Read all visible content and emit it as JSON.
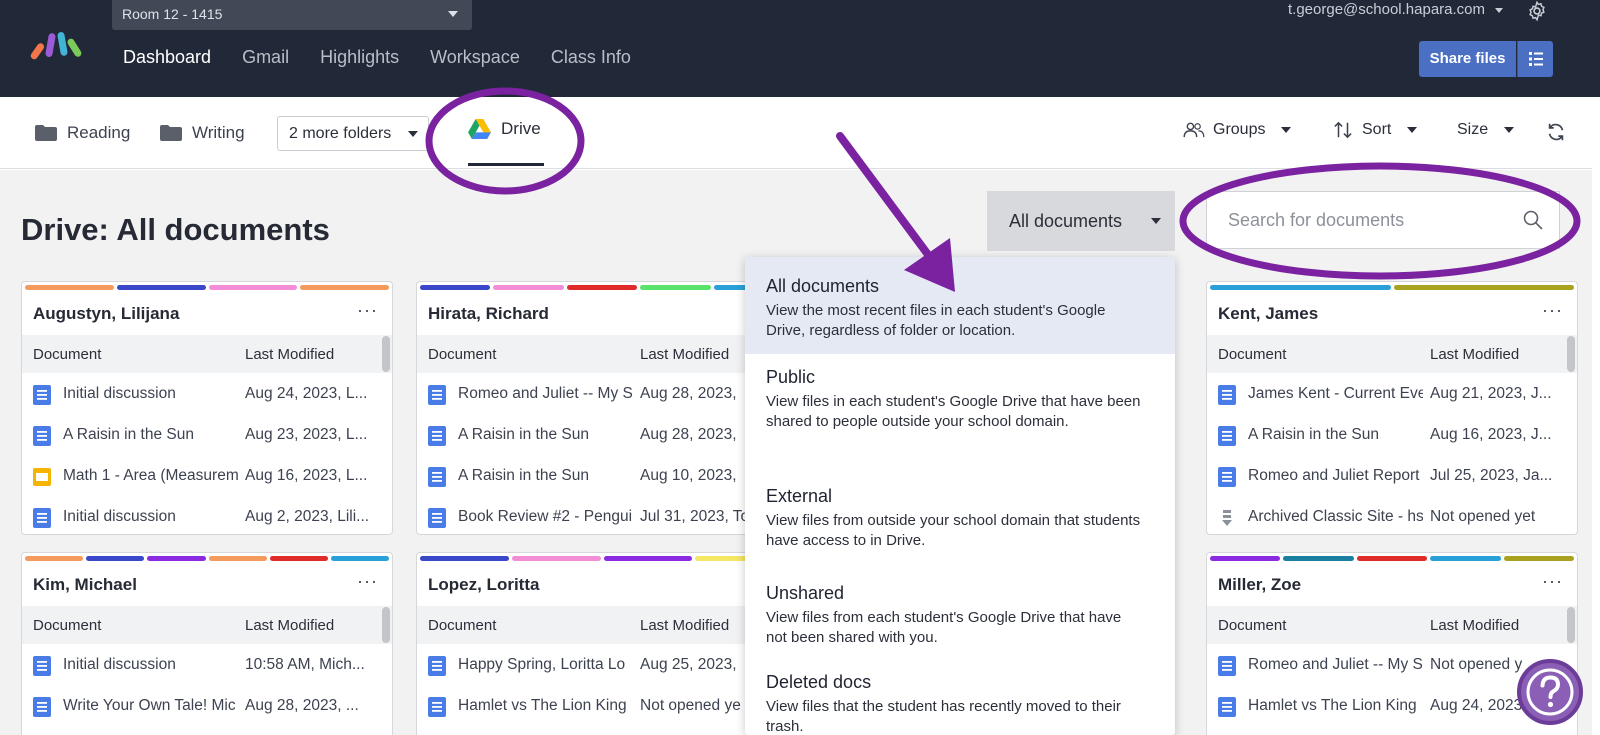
{
  "header": {
    "class_select": "Room 12 - 1415",
    "nav": [
      "Dashboard",
      "Gmail",
      "Highlights",
      "Workspace",
      "Class Info"
    ],
    "active_nav": "Dashboard",
    "account": "t.george@school.hapara.com",
    "share_button": "Share files"
  },
  "folderbar": {
    "folders": [
      "Reading",
      "Writing"
    ],
    "more_folders": "2 more folders",
    "drive_tab": "Drive",
    "groups": "Groups",
    "sort": "Sort",
    "size": "Size"
  },
  "main": {
    "title": "Drive: All documents",
    "filter": "All documents",
    "search_placeholder": "Search for documents"
  },
  "columns": {
    "document": "Document",
    "last_modified": "Last Modified"
  },
  "cards": [
    {
      "name": "Augustyn, Lilijana",
      "stripe": [
        "#f39a5c",
        "#3a47c9",
        "#f38ed6",
        "#f39a5c"
      ],
      "rows": [
        {
          "icon": "doc",
          "name": "Initial discussion",
          "date": "Aug 24, 2023, L..."
        },
        {
          "icon": "doc",
          "name": "A Raisin in the Sun",
          "date": "Aug 23, 2023, L..."
        },
        {
          "icon": "slides",
          "name": "Math 1 - Area (Measurem",
          "date": "Aug 16, 2023, L..."
        },
        {
          "icon": "doc",
          "name": "Initial discussion",
          "date": "Aug 2, 2023, Lili..."
        }
      ]
    },
    {
      "name": "Hirata, Richard",
      "stripe": [
        "#3a47c9",
        "#f38ed6",
        "#e02b2b",
        "#5ae36b",
        "#2aa0d8"
      ],
      "rows": [
        {
          "icon": "doc",
          "name": "Romeo and Juliet -- My St",
          "date": "Aug 28, 2023,"
        },
        {
          "icon": "doc",
          "name": "A Raisin in the Sun",
          "date": "Aug 28, 2023,"
        },
        {
          "icon": "doc",
          "name": "A Raisin in the Sun",
          "date": "Aug 10, 2023,"
        },
        {
          "icon": "doc",
          "name": "Book Review #2 - Pengui",
          "date": "Jul 31, 2023, To"
        }
      ]
    },
    {
      "name": "Kent, James",
      "stripe": [
        "#2aa0d8",
        "#a8a21e"
      ],
      "rows": [
        {
          "icon": "doc",
          "name": "James Kent - Current Eve",
          "date": "Aug 21, 2023, J..."
        },
        {
          "icon": "doc",
          "name": "A Raisin in the Sun",
          "date": "Aug 16, 2023, J..."
        },
        {
          "icon": "doc",
          "name": "Romeo and Juliet Report",
          "date": "Jul 25, 2023, Ja..."
        },
        {
          "icon": "site",
          "name": "Archived Classic Site - hs",
          "date": "Not opened yet"
        }
      ]
    },
    {
      "name": "Kim, Michael",
      "stripe": [
        "#f39a5c",
        "#3a47c9",
        "#8a2be2",
        "#f39a5c",
        "#e02b2b",
        "#2aa0d8"
      ],
      "rows": [
        {
          "icon": "doc",
          "name": "Initial discussion",
          "date": "10:58 AM, Mich..."
        },
        {
          "icon": "doc",
          "name": "Write Your Own Tale! Mic",
          "date": "Aug 28, 2023, ..."
        }
      ]
    },
    {
      "name": "Lopez, Loritta",
      "stripe": [
        "#3a47c9",
        "#f38ed6",
        "#8a2be2",
        "#f5e663"
      ],
      "rows": [
        {
          "icon": "doc",
          "name": "Happy Spring, Loritta Lo",
          "date": "Aug 25, 2023,"
        },
        {
          "icon": "doc",
          "name": "Hamlet vs The Lion King",
          "date": "Not opened ye"
        }
      ]
    },
    {
      "name": "Miller, Zoe",
      "stripe": [
        "#8a2be2",
        "#1a7fa0",
        "#e02b2b",
        "#2aa0d8",
        "#a8a21e"
      ],
      "rows": [
        {
          "icon": "doc",
          "name": "Romeo and Juliet -- My St",
          "date": "Not opened y"
        },
        {
          "icon": "doc",
          "name": "Hamlet vs The Lion King",
          "date": "Aug 24, 2023,"
        }
      ]
    }
  ],
  "dropdown": [
    {
      "title": "All documents",
      "desc": "View the most recent files in each student's Google Drive, regardless of folder or location.",
      "selected": true
    },
    {
      "title": "Public",
      "desc": "View files in each student's Google Drive that have been shared to people outside your school domain.",
      "selected": false
    },
    {
      "title": "External",
      "desc": "View files from outside your school domain that students have access to in Drive.",
      "selected": false
    },
    {
      "title": "Unshared",
      "desc": "View files from each student's Google Drive that have not been shared with you.",
      "selected": false
    },
    {
      "title": "Deleted docs",
      "desc": "View files that the student has recently moved to their trash.",
      "selected": false
    }
  ],
  "colors": {
    "topbar": "#212838",
    "accent_button": "#4a6fc3",
    "annotation": "#7a22a0",
    "doc_icon": "#4a7ce8",
    "slides_icon": "#f4b400"
  }
}
